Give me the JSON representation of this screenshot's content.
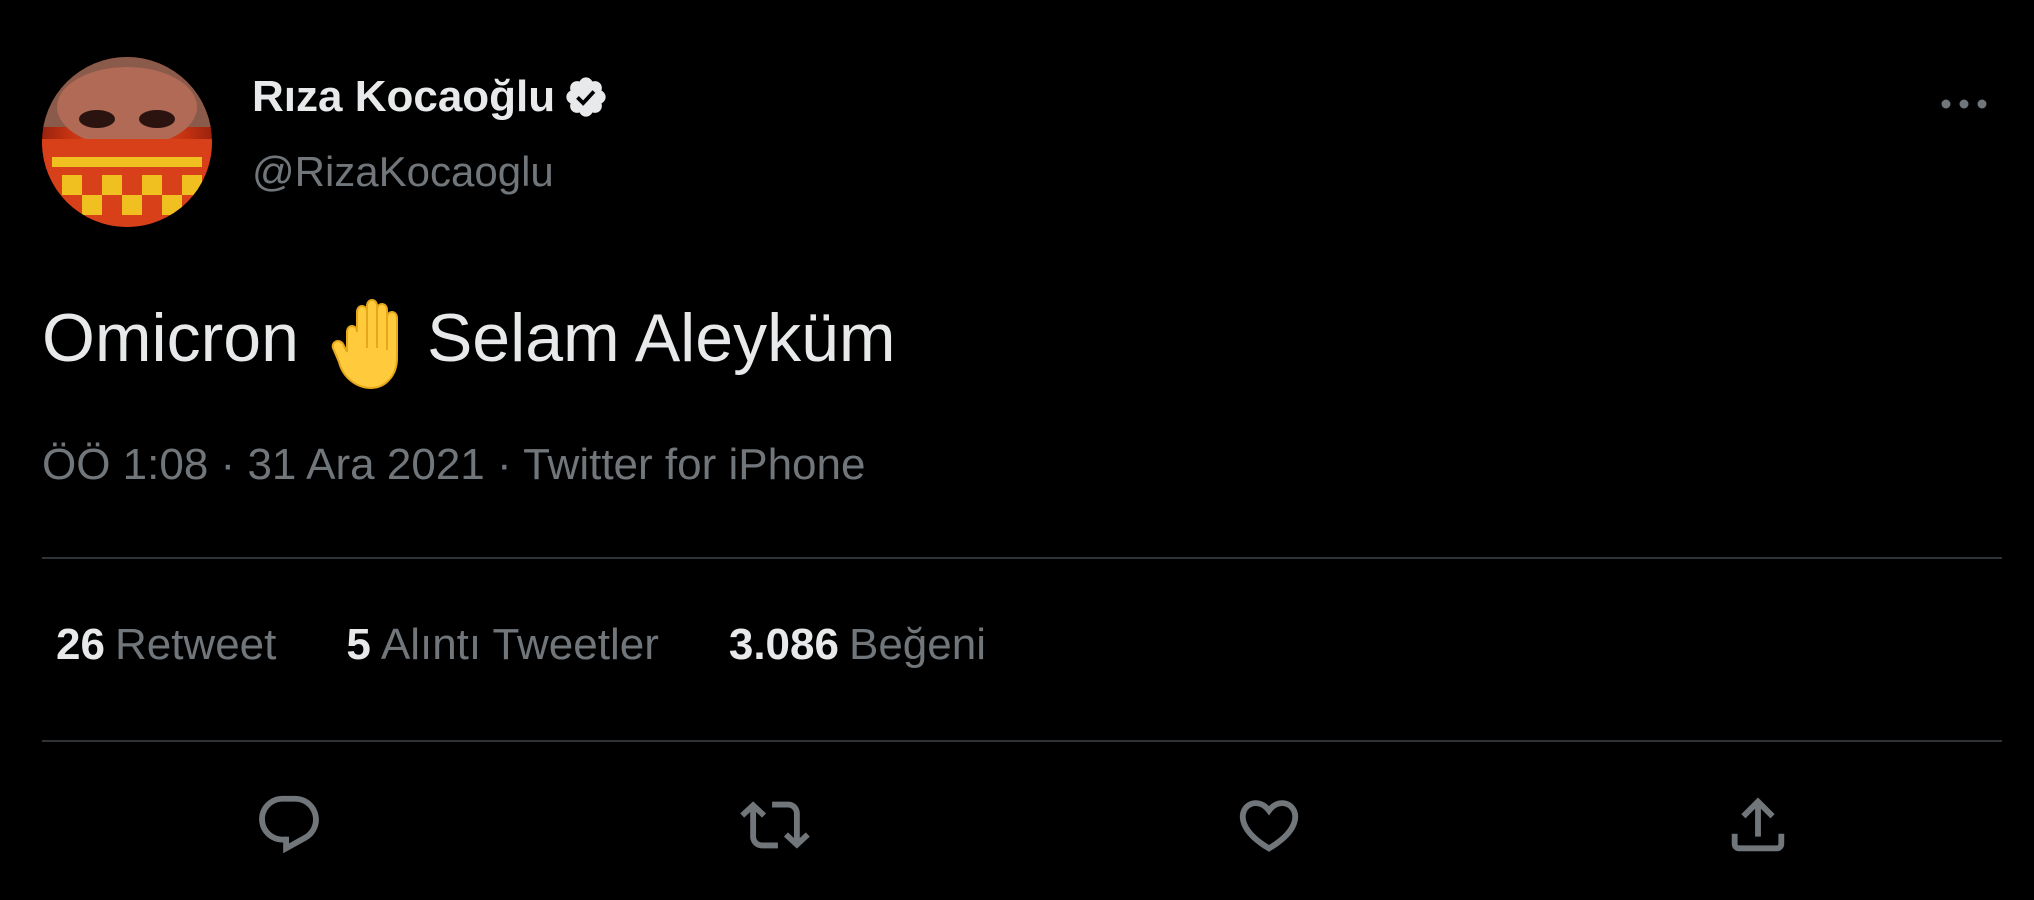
{
  "author": {
    "display_name": "Rıza Kocaoğlu",
    "handle": "@RizaKocaoglu",
    "verified": true,
    "avatar_icon": "avatar-photo"
  },
  "tweet": {
    "text_before": "Omicron",
    "emoji": "raised-hand-icon",
    "text_after": "Selam Aleyküm"
  },
  "meta": {
    "time": "ÖÖ 1:08",
    "separator1": "·",
    "date": "31 Ara 2021",
    "separator2": "·",
    "source": "Twitter for iPhone"
  },
  "stats": {
    "retweets_count": "26",
    "retweets_label": "Retweet",
    "quotes_count": "5",
    "quotes_label": "Alıntı Tweetler",
    "likes_count": "3.086",
    "likes_label": "Beğeni"
  },
  "actions": [
    "reply-icon",
    "retweet-icon",
    "like-icon",
    "share-icon"
  ],
  "colors": {
    "background": "#000000",
    "text_primary": "#e7e9ea",
    "text_secondary": "#71767b",
    "divider": "#2f3336"
  }
}
